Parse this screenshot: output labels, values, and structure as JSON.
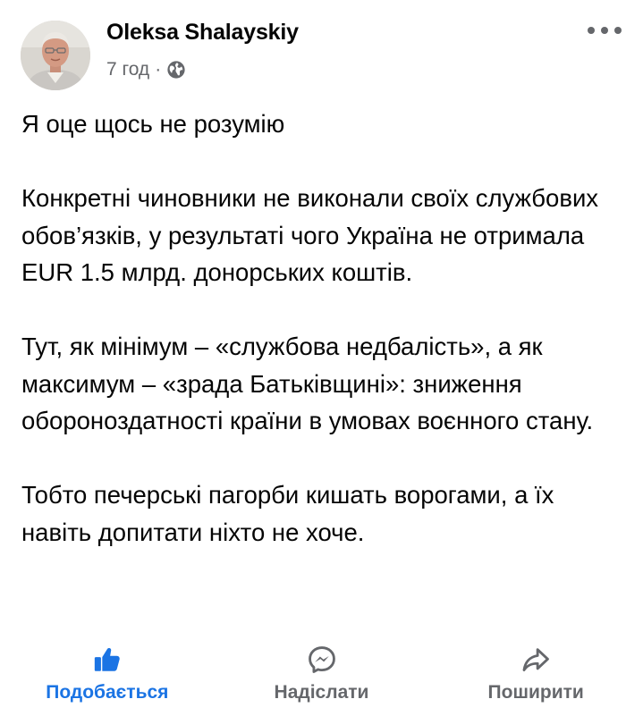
{
  "post": {
    "author": "Oleksa Shalayskiy",
    "time": "7 год",
    "separator": "·",
    "visibility_icon": "globe-icon",
    "menu_icon": "more-options-icon",
    "avatar_icon": "profile-photo",
    "paragraphs": [
      "Я оце щось не розумію",
      "Конкретні чиновники не виконали своїх службових обов’язків, у результаті чого Україна не отримала EUR 1.5 млрд. донорських коштів.",
      "Тут, як мінімум – «службова недбалість», а як максимум – «зрада Батьківщині»: зниження обороноздатності країни в умовах воєнного стану.",
      "Тобто печерські пагорби кишать ворогами, а їх навіть допитати ніхто не хоче."
    ]
  },
  "actions": {
    "like": "Подобається",
    "send": "Надіслати",
    "share": "Поширити"
  },
  "colors": {
    "accent": "#1b74e4",
    "secondary_text": "#65676b",
    "primary_text": "#050505"
  }
}
